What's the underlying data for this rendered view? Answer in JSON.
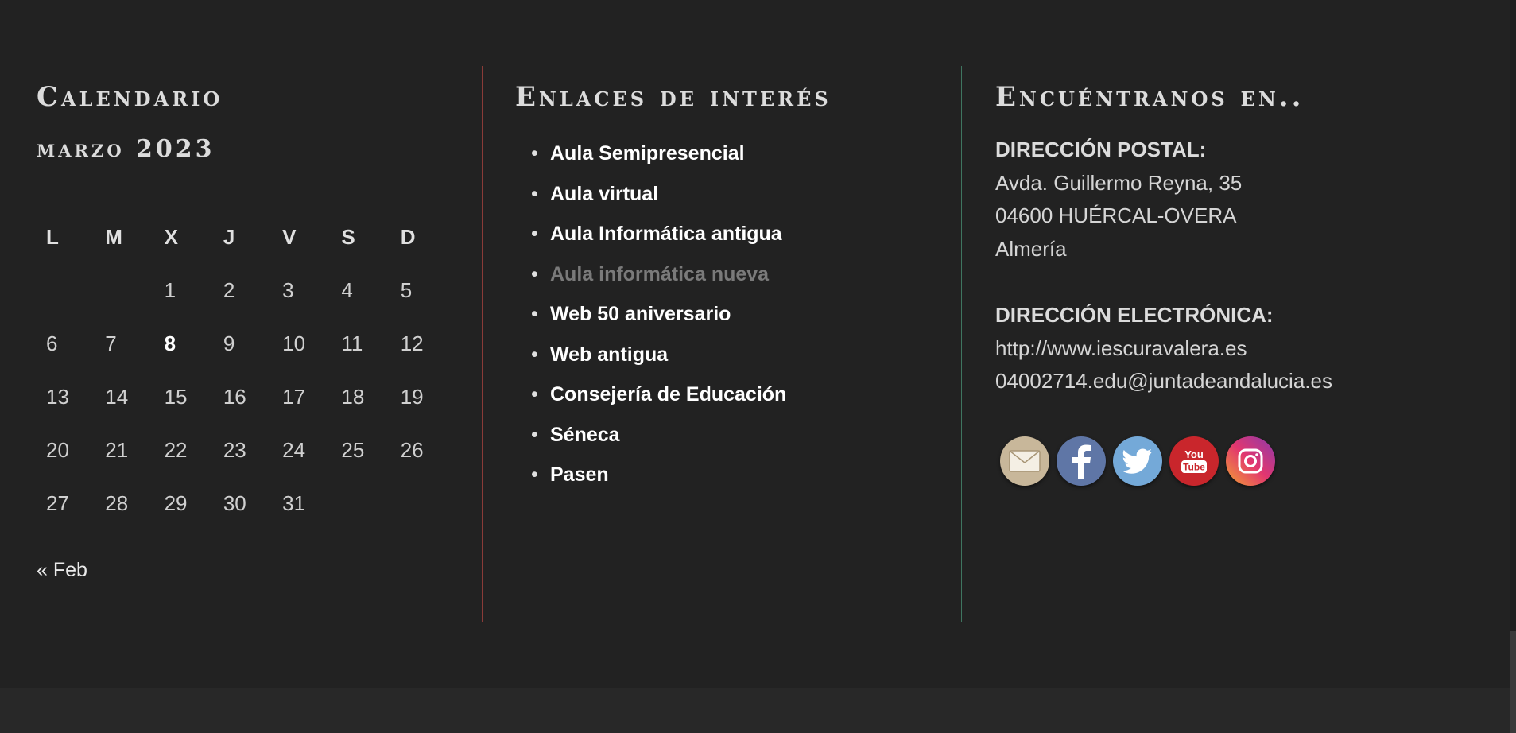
{
  "calendar": {
    "title": "Calendario",
    "caption": "marzo 2023",
    "weekdays": [
      "L",
      "M",
      "X",
      "J",
      "V",
      "S",
      "D"
    ],
    "weeks": [
      [
        "",
        "",
        "1",
        "2",
        "3",
        "4",
        "5"
      ],
      [
        "6",
        "7",
        "8",
        "9",
        "10",
        "11",
        "12"
      ],
      [
        "13",
        "14",
        "15",
        "16",
        "17",
        "18",
        "19"
      ],
      [
        "20",
        "21",
        "22",
        "23",
        "24",
        "25",
        "26"
      ],
      [
        "27",
        "28",
        "29",
        "30",
        "31",
        "",
        ""
      ]
    ],
    "today": "8",
    "prev_link": "« Feb"
  },
  "links": {
    "title": "Enlaces de interés",
    "items": [
      {
        "label": "Aula Semipresencial"
      },
      {
        "label": "Aula virtual"
      },
      {
        "label": "Aula Informática antigua"
      },
      {
        "label": "Aula informática nueva"
      },
      {
        "label": "Web 50 aniversario"
      },
      {
        "label": "Web antigua"
      },
      {
        "label": "Consejería de Educación"
      },
      {
        "label": "Séneca"
      },
      {
        "label": "Pasen"
      }
    ]
  },
  "contact": {
    "title": "Encuéntranos en..",
    "postal_label": "DIRECCIÓN POSTAL:",
    "postal_lines": [
      "Avda. Guillermo Reyna, 35",
      "04600 HUÉRCAL-OVERA",
      "Almería"
    ],
    "electronic_label": "DIRECCIÓN ELECTRÓNICA:",
    "website": "http://www.iescuravalera.es",
    "email": "04002714.edu@juntadeandalucia.es"
  },
  "social": [
    {
      "icon": "envelope-icon",
      "color": "#c8b79a"
    },
    {
      "icon": "facebook-icon",
      "color": "#5f76a6"
    },
    {
      "icon": "twitter-icon",
      "color": "#74a9d8"
    },
    {
      "icon": "youtube-icon",
      "color": "#c9262c"
    },
    {
      "icon": "instagram-icon",
      "color": "#c4337f"
    }
  ],
  "colors": {
    "background": "#222222",
    "divider_red": "#8a3b38",
    "divider_green": "#3f7560"
  }
}
